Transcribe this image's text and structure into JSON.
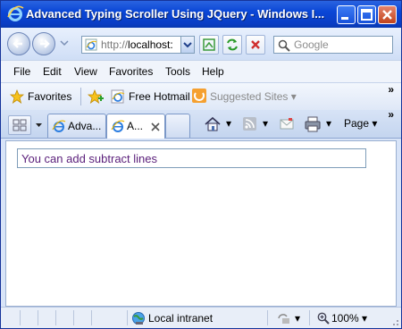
{
  "window": {
    "title": "Advanced Typing Scroller Using JQuery - Windows I..."
  },
  "address": {
    "url_prefix": "http://",
    "url_host": "localhost:"
  },
  "search": {
    "placeholder": "Google"
  },
  "menu": [
    "File",
    "Edit",
    "View",
    "Favorites",
    "Tools",
    "Help"
  ],
  "favorites_bar": {
    "favorites_label": "Favorites",
    "free_hotmail": "Free Hotmail",
    "suggested_sites": "Suggested Sites"
  },
  "tabs": [
    {
      "label": "Adva..."
    },
    {
      "label": "A..."
    }
  ],
  "command_bar": {
    "page_label": "Page"
  },
  "content": {
    "input_value": "You can add subtract lines"
  },
  "status": {
    "zone": "Local intranet",
    "zoom": "100%"
  },
  "colors": {
    "titlebar": "#0a46d6",
    "input_text": "#5a1e7a"
  }
}
